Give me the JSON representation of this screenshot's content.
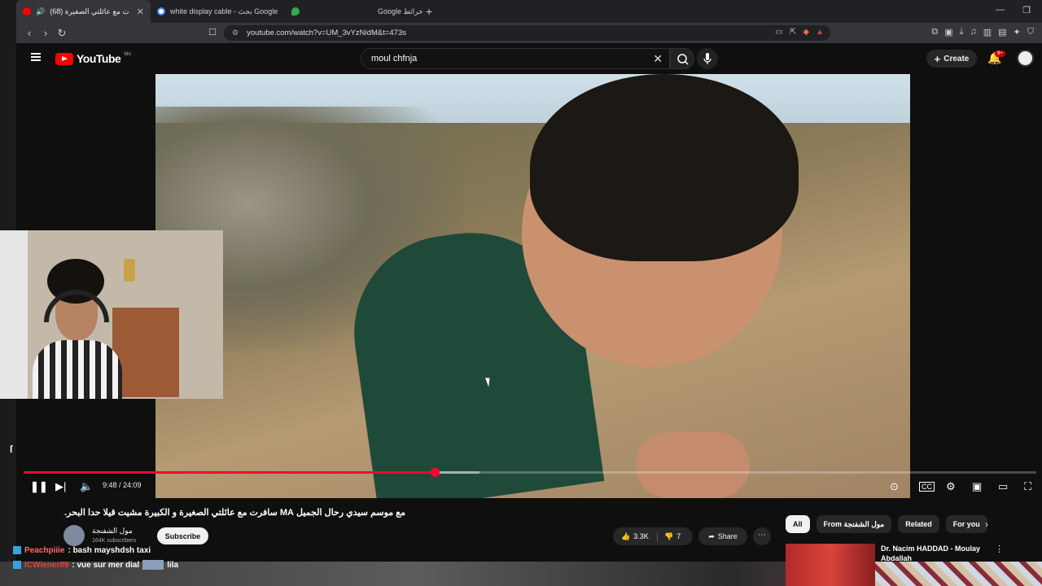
{
  "browser": {
    "tabs": [
      {
        "label": "(68) سافرت مع عائلتي الصغيرة",
        "active": true,
        "favicon_color": "#ff0000"
      },
      {
        "label": "white display cable - بحث Google",
        "active": false,
        "favicon_color": "#4285f4"
      },
      {
        "label": "Google خرائط",
        "active": false,
        "favicon_color": "#34a853"
      }
    ],
    "new_tab": "+",
    "url": "youtube.com/watch?v=UM_3vYzNidM&t=473s"
  },
  "youtube": {
    "logo_text": "YouTube",
    "country_code": "MA",
    "search": {
      "value": "moul chfnja"
    },
    "create_label": "Create",
    "notification_badge": "9+"
  },
  "player": {
    "time": "9:48 / 24:09",
    "progress_fraction": 0.406,
    "buffered_fraction": 0.45
  },
  "video": {
    "title": "مع موسم سيدي رحال الجميل MA سافرت مع عائلتي الصغيرة و الكبيرة مشيت قيلا حدا البحر...",
    "channel_name": "مول الشفنجة",
    "subscribers": "164K subscribers",
    "subscribe_label": "Subscribe",
    "likes": "3.3K",
    "dislikes": "7",
    "share_label": "Share"
  },
  "sidebar": {
    "chips": [
      {
        "label": "All",
        "selected": true
      },
      {
        "label": "From مول الشفنجة",
        "selected": false
      },
      {
        "label": "Related",
        "selected": false
      },
      {
        "label": "For you",
        "selected": false
      }
    ],
    "recommendation": {
      "title": "Dr. Nacim HADDAD - Moulay Abdallah"
    }
  },
  "chat": [
    {
      "user": "Peachpiiie",
      "message": ": bash mayshdsh taxi"
    },
    {
      "user": "ICWiener89",
      "message": ": vue sur mer dial",
      "extra": "lila"
    }
  ],
  "colors": {
    "accent": "#ff0033",
    "youtube_red": "#ff0000",
    "background": "#0f0f0f"
  }
}
